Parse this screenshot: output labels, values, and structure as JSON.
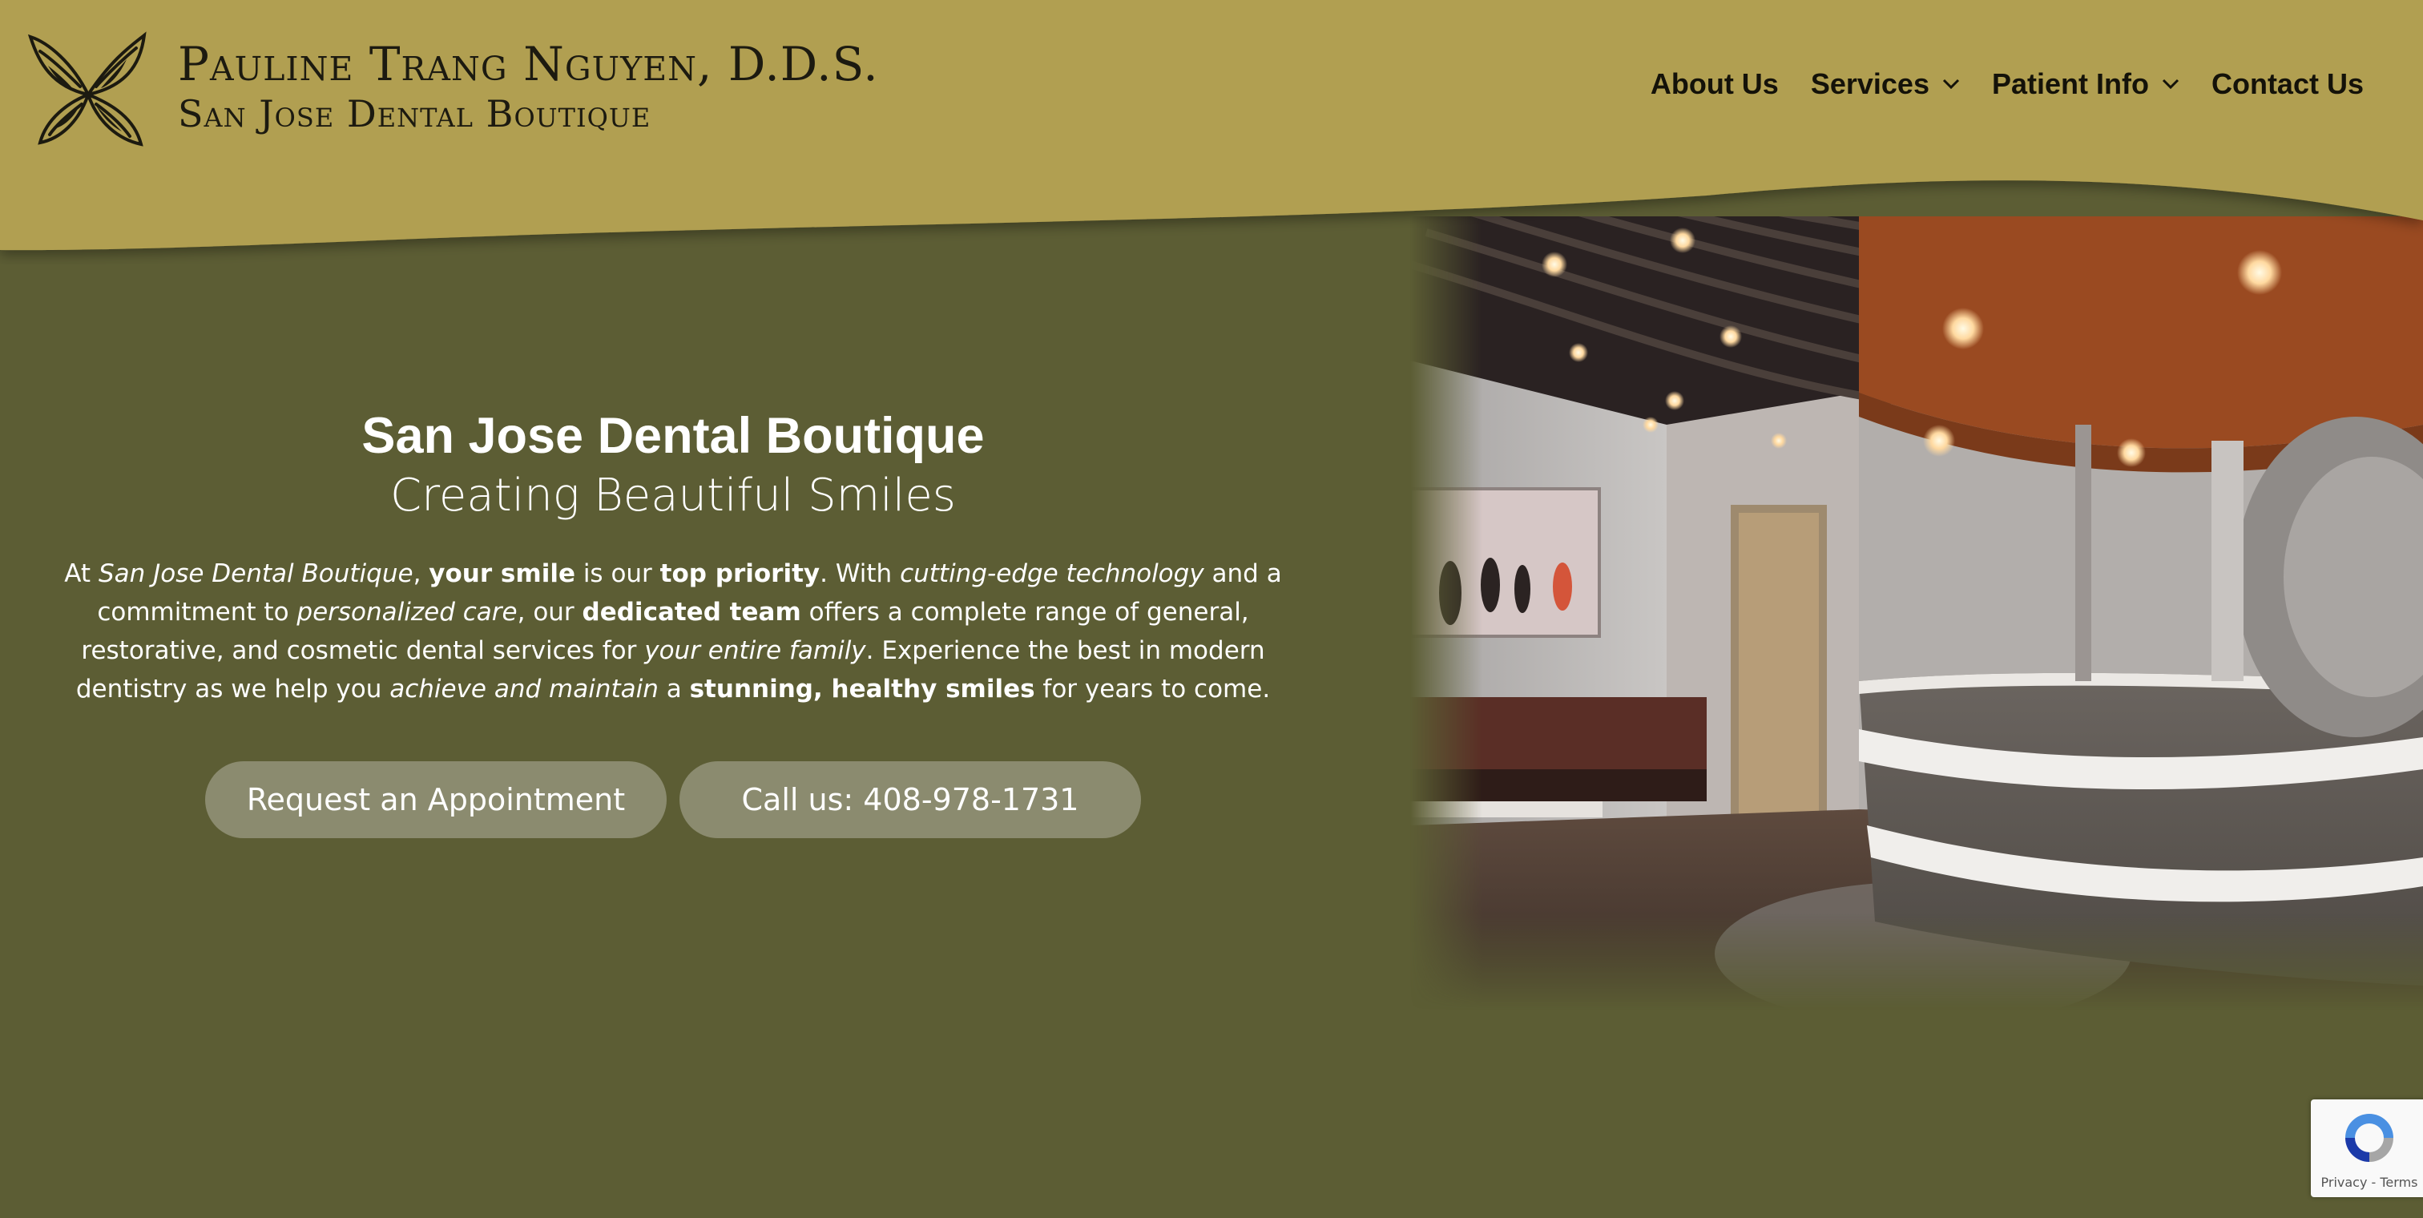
{
  "colors": {
    "header_gold": "#b19f51",
    "hero_olive": "#5c5d34",
    "button_fill": "#8b8b6f",
    "text_dark": "#141209",
    "text_light": "#ffffff"
  },
  "logo": {
    "icon": "butterfly-icon",
    "line1": "Pauline Trang Nguyen, D.D.S.",
    "line2": "San Jose Dental Boutique"
  },
  "nav": {
    "items": [
      {
        "label": "About Us",
        "has_dropdown": false
      },
      {
        "label": "Services",
        "has_dropdown": true
      },
      {
        "label": "Patient Info",
        "has_dropdown": true
      },
      {
        "label": "Contact Us",
        "has_dropdown": false
      }
    ]
  },
  "hero": {
    "title": "San Jose Dental Boutique",
    "subtitle": "Creating Beautiful Smiles",
    "description": {
      "t1": "At ",
      "t2": "San Jose Dental Boutique",
      "t3": ", ",
      "t4": "your smile",
      "t5": " is our ",
      "t6": "top priority",
      "t7": ". With ",
      "t8": "cutting-edge technology",
      "t9": " and a commitment to ",
      "t10": "personalized care",
      "t11": ", our ",
      "t12": "dedicated team",
      "t13": " offers a complete range of general, restorative, and cosmetic dental services for ",
      "t14": "your entire family",
      "t15": ". Experience the best in modern dentistry as we help you ",
      "t16": "achieve and maintain",
      "t17": " a ",
      "t18": "stunning, healthy smiles",
      "t19": " for years to come."
    },
    "cta_primary": "Request an Appointment",
    "cta_secondary": "Call us: 408-978-1731"
  },
  "recaptcha": {
    "icon": "recaptcha-icon",
    "links": "Privacy - Terms"
  }
}
